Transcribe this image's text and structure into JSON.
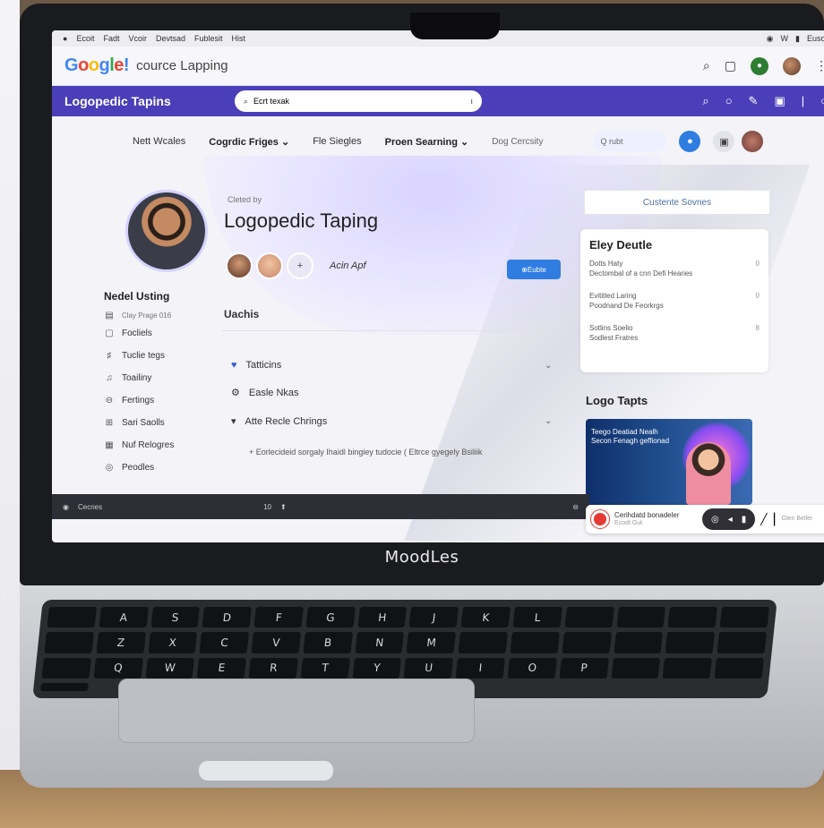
{
  "menubar": {
    "items": [
      "Ecoit",
      "Fadt",
      "Vcoir",
      "Devtsad",
      "Fublesit",
      "Hist"
    ],
    "right": [
      "W",
      "Eusos"
    ]
  },
  "browser": {
    "logo": {
      "b": "G",
      "r": "o",
      "y": "o",
      "b2": "g",
      "g": "l",
      "r2": "e",
      "bang": "!"
    },
    "title": "cource Lapping"
  },
  "appbar": {
    "title": "Logopedic Tapins",
    "search_value": "Ecrt texak"
  },
  "subnav": {
    "items": [
      "Nett Wcales",
      "Cogrdic Friges",
      "Fle Siegles",
      "Proen Searning",
      "Dog Cercsity"
    ],
    "search_value": "Q rubt"
  },
  "hero": {
    "created_by": "Cleted by",
    "course_title": "Logopedic Taping",
    "add_label": "Acin Apf",
    "button": "Eubte"
  },
  "sidebar": {
    "heading": "Nedel Usting",
    "sub": "Clay Prage 016",
    "items": [
      "Focliels",
      "Tuclie tegs",
      "Toailiny",
      "Fertings",
      "Sari Saolls",
      "Nuf Relogres",
      "Peodles"
    ]
  },
  "main": {
    "section_title": "Uachis",
    "accordion": [
      "Tatticins",
      "Easle Nkas",
      "Atte Recle Chrings"
    ],
    "sub_item": "Eorlecideid sorgaly Ihaidl bingiey tudocie ( Eltrce gyegely Bsiliik"
  },
  "right": {
    "course_button": "Custente Sovnes",
    "card_title": "Eley Deutle",
    "rows": [
      {
        "a": "Dotts Haty",
        "b": "Dectombal of a cnn Defi Hearies",
        "n": "0"
      },
      {
        "a": "Evititled Laring",
        "b": "Poodnand De Feorkrgs",
        "n": "0"
      },
      {
        "a": "Sotlins Soelio",
        "b": "Sodlest Fratres",
        "n": "8"
      }
    ],
    "logo_title": "Logo Tapts",
    "thumb_text": "Teego Deatiad Nealh Secon Fenagh geffionad"
  },
  "bottombar": {
    "label": "Cecnes",
    "page": "10"
  },
  "call": {
    "name": "Cerihdatd bonadeler",
    "sub": "Ecodt Gut",
    "end": "Glen Beller"
  },
  "brand": "MoodLes",
  "keys": [
    "",
    "A",
    "S",
    "D",
    "F",
    "G",
    "H",
    "J",
    "K",
    "L",
    "",
    "",
    "",
    "",
    "",
    "Z",
    "X",
    "C",
    "V",
    "B",
    "N",
    "M",
    "",
    "",
    "",
    "",
    "",
    "",
    "",
    "Q",
    "W",
    "E",
    "R",
    "T",
    "Y",
    "U",
    "I",
    "O",
    "P",
    "",
    "",
    "",
    ""
  ],
  "colors": {
    "appbar": "#4a3fb8",
    "primary": "#2f7de1",
    "record": "#e53935"
  }
}
